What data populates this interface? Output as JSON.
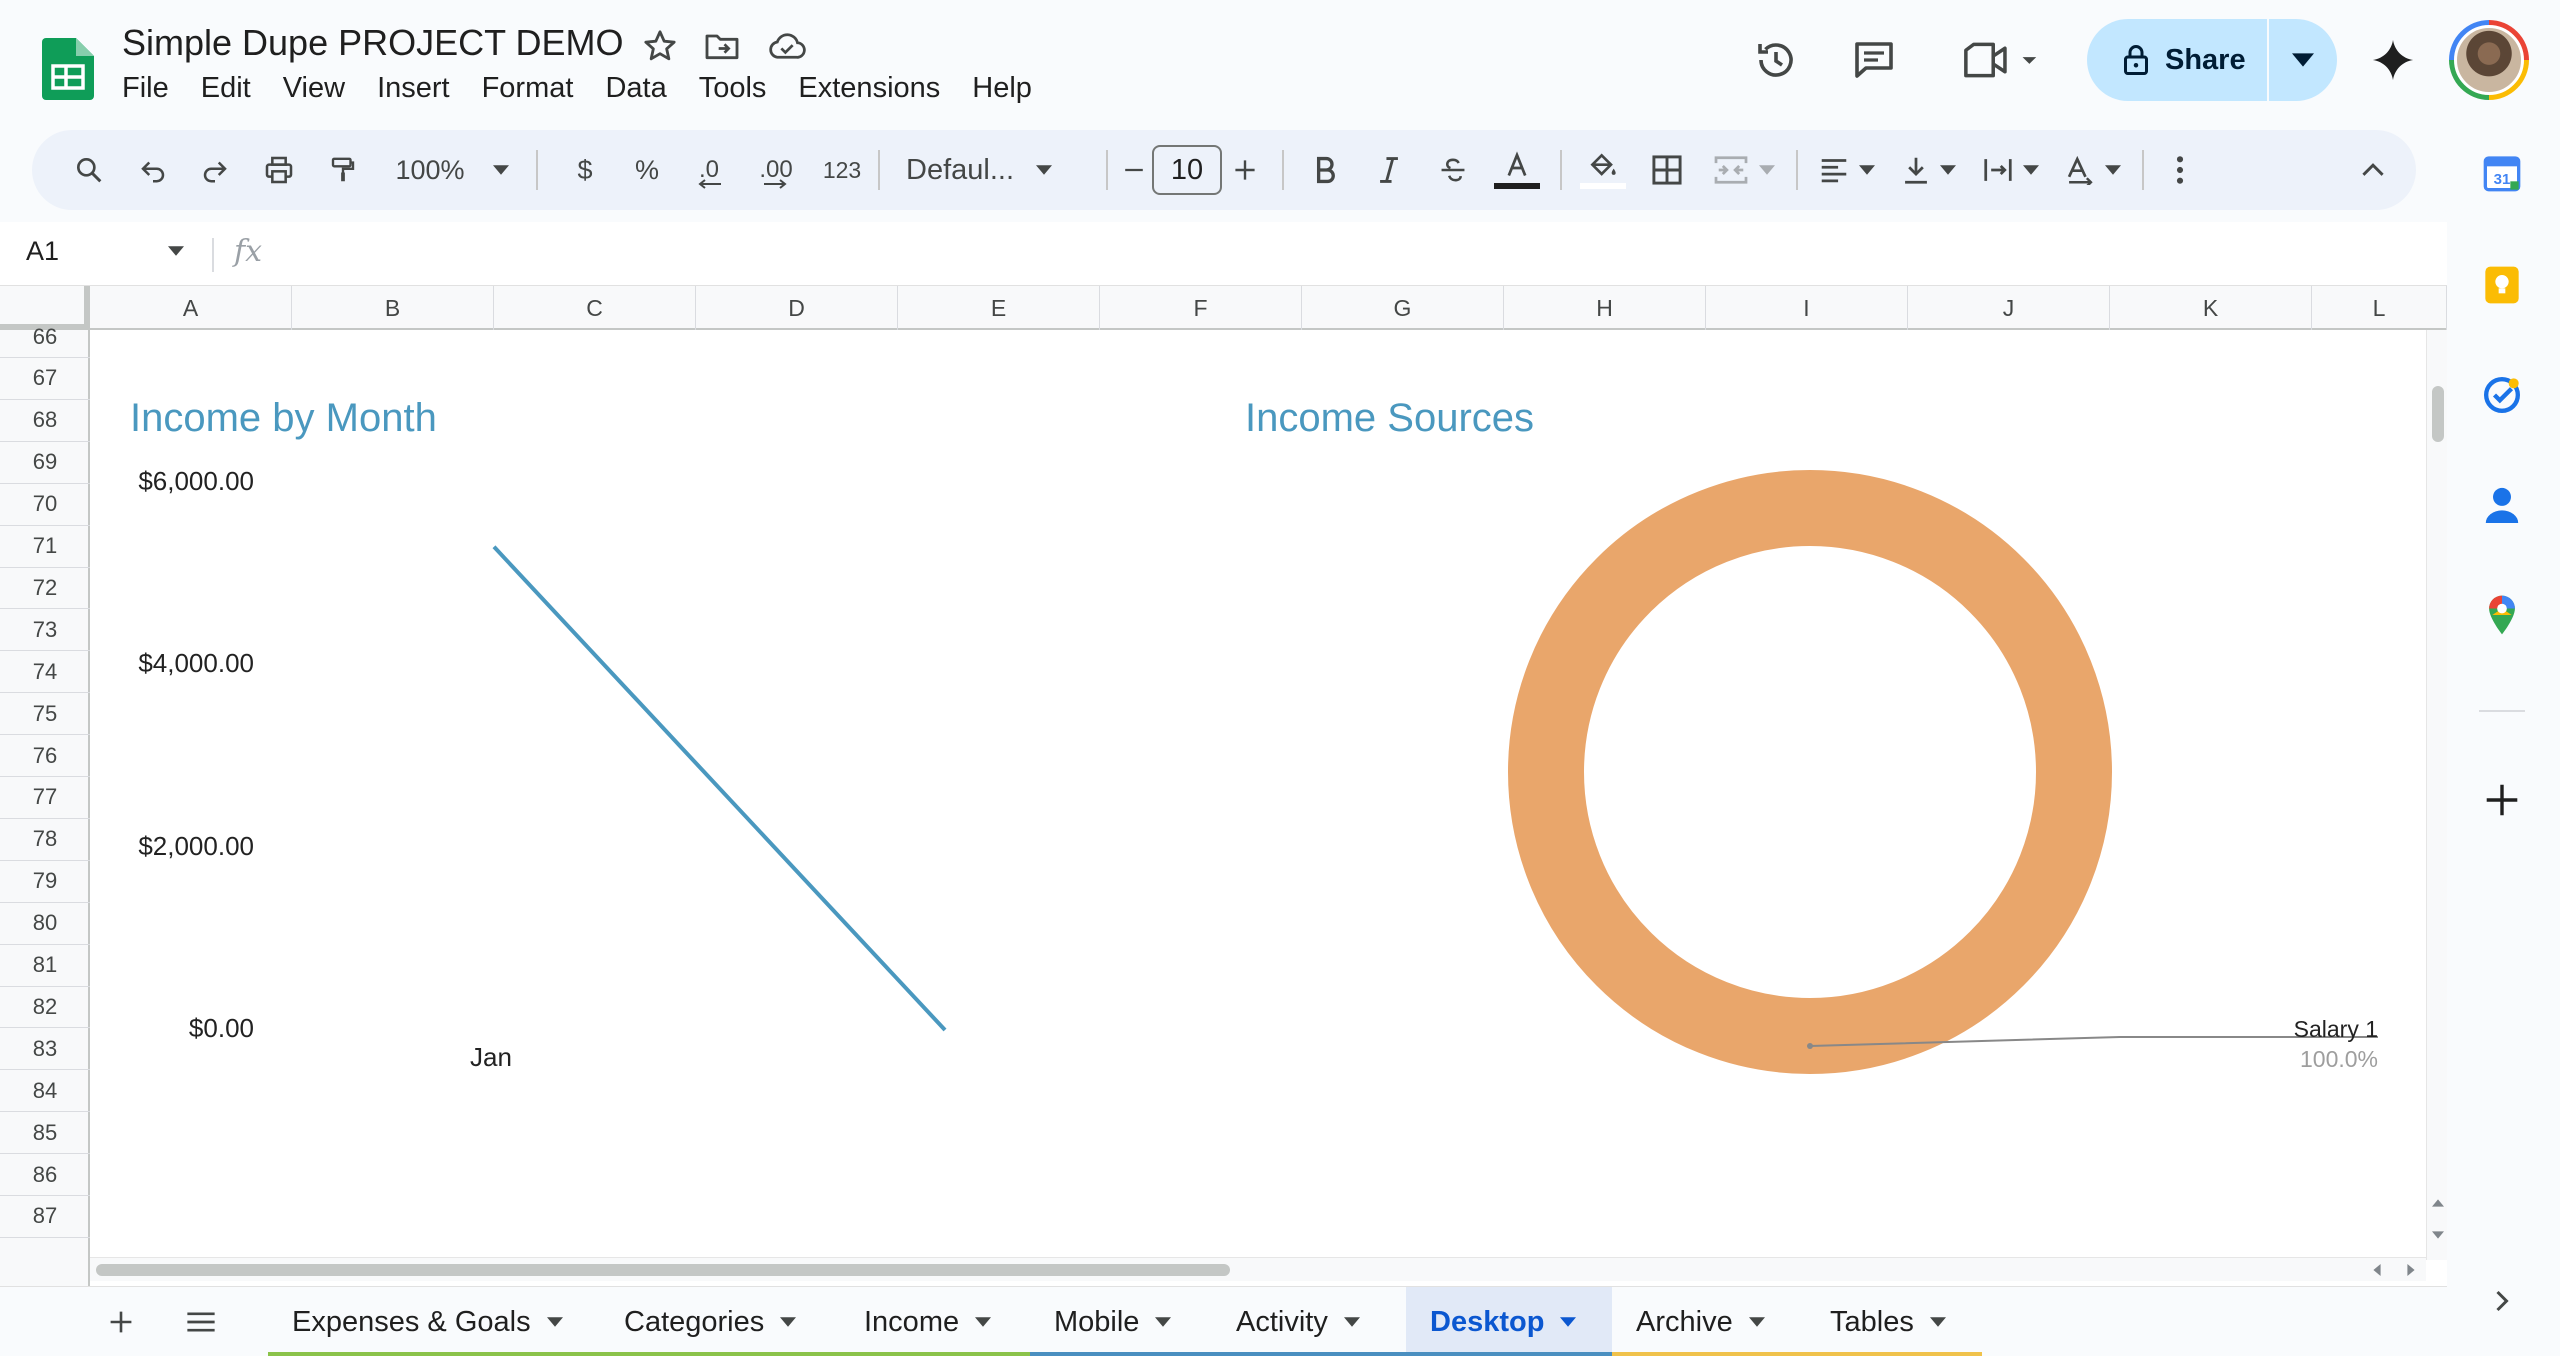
{
  "app": {
    "doc_title": "Simple Dupe PROJECT DEMO",
    "menu": [
      "File",
      "Edit",
      "View",
      "Insert",
      "Format",
      "Data",
      "Tools",
      "Extensions",
      "Help"
    ],
    "share_label": "Share"
  },
  "toolbar": {
    "zoom": "100%",
    "currency": "$",
    "percent": "%",
    "dec_decrease": ".0",
    "dec_increase": ".00",
    "number_format": "123",
    "font": "Defaul...",
    "font_size": "10"
  },
  "formula_bar": {
    "name_box": "A1",
    "fx": "fx",
    "formula": ""
  },
  "grid": {
    "columns": [
      "A",
      "B",
      "C",
      "D",
      "E",
      "F",
      "G",
      "H",
      "I",
      "J",
      "K",
      "L"
    ],
    "rows": [
      "66",
      "67",
      "68",
      "69",
      "70",
      "71",
      "72",
      "73",
      "74",
      "75",
      "76",
      "77",
      "78",
      "79",
      "80",
      "81",
      "82",
      "83",
      "84",
      "85",
      "86",
      "87"
    ]
  },
  "charts": {
    "income_by_month_title": "Income by Month",
    "income_sources_title": "Income Sources",
    "pie_label": "Salary 1",
    "pie_pct": "100.0%"
  },
  "chart_data": [
    {
      "type": "line",
      "title": "Income by Month",
      "x": [
        "Jan"
      ],
      "y_tick_labels": [
        "$6,000.00",
        "$4,000.00",
        "$2,000.00",
        "$0.00"
      ],
      "ylim": [
        0,
        6000
      ],
      "series": [
        {
          "color": "#4a98bf",
          "values": [
            5300,
            0
          ]
        }
      ]
    },
    {
      "type": "pie",
      "title": "Income Sources",
      "donut": true,
      "slices": [
        {
          "label": "Salary 1",
          "value": 100.0,
          "percent": "100.0%",
          "color": "#e9a66b"
        }
      ]
    }
  ],
  "sheet_tabs": [
    {
      "name": "Expenses & Goals",
      "color": "#8bc34a",
      "active": false
    },
    {
      "name": "Categories",
      "color": "#8bc34a",
      "active": false
    },
    {
      "name": "Income",
      "color": "#8bc34a",
      "active": false
    },
    {
      "name": "Mobile",
      "color": "#4a8fc0",
      "active": false
    },
    {
      "name": "Activity",
      "color": "#4a8fc0",
      "active": false
    },
    {
      "name": "Desktop",
      "color": "#4a8fc0",
      "active": true
    },
    {
      "name": "Archive",
      "color": "#f0c24b",
      "active": false
    },
    {
      "name": "Tables",
      "color": "#f0c24b",
      "active": false
    }
  ],
  "side_panel": [
    "calendar-icon",
    "keep-icon",
    "tasks-icon",
    "contacts-icon",
    "maps-icon",
    "add-icon"
  ]
}
